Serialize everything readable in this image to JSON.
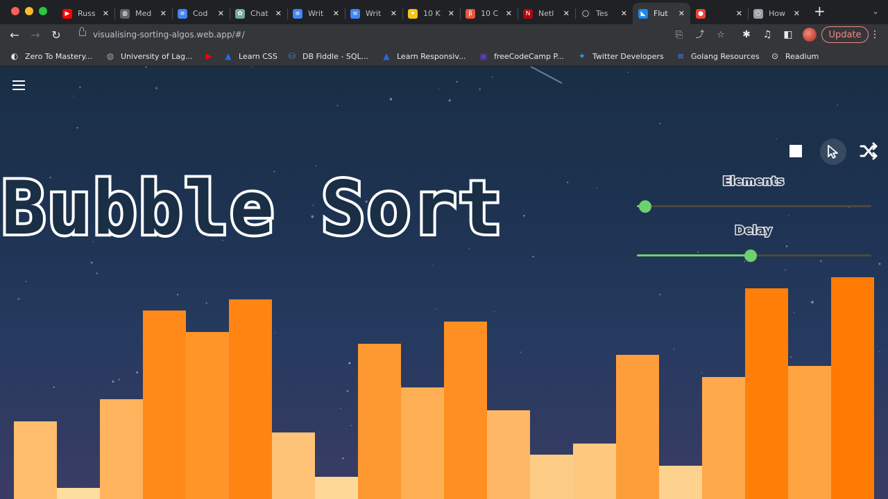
{
  "browser": {
    "tabs": [
      {
        "title": "Russ",
        "favicon": "youtube-icon",
        "color": "#ff0000",
        "glyph": "▶"
      },
      {
        "title": "Med",
        "favicon": "globe-icon",
        "color": "#5f6368",
        "glyph": "◍"
      },
      {
        "title": "Cod",
        "favicon": "docs-icon",
        "color": "#4285f4",
        "glyph": "≡"
      },
      {
        "title": "Chat",
        "favicon": "chatgpt-icon",
        "color": "#74aa9c",
        "glyph": "✿"
      },
      {
        "title": "Writ",
        "favicon": "docs-icon",
        "color": "#4285f4",
        "glyph": "≡"
      },
      {
        "title": "Writ",
        "favicon": "docs-icon",
        "color": "#4285f4",
        "glyph": "≡"
      },
      {
        "title": "10 K",
        "favicon": "star-icon",
        "color": "#f5c518",
        "glyph": "✦"
      },
      {
        "title": "10 C",
        "favicon": "hashnode-icon",
        "color": "#e8553e",
        "glyph": "β"
      },
      {
        "title": "Netl",
        "favicon": "netflix-icon",
        "color": "#b00710",
        "glyph": "N"
      },
      {
        "title": "Tes",
        "favicon": "github-icon",
        "color": "#24292e",
        "glyph": "◯"
      },
      {
        "title": "Flut",
        "favicon": "flutter-icon",
        "color": "#1e88e5",
        "glyph": "◣"
      },
      {
        "title": "",
        "favicon": "record-icon",
        "color": "#ea4335",
        "glyph": "●"
      },
      {
        "title": "How",
        "favicon": "cube-icon",
        "color": "#9aa0a6",
        "glyph": "⬡"
      }
    ],
    "active_tab_index": 10,
    "new_tab_label": "+",
    "url": "visualising-sorting-algos.web.app/#/",
    "update_label": "Update",
    "bookmarks": [
      {
        "label": "Zero To Mastery...",
        "icon": "ztm-icon",
        "color": "#e8eaed",
        "glyph": "◐"
      },
      {
        "label": "University of Lag...",
        "icon": "globe-icon",
        "color": "#9aa0a6",
        "glyph": "◍"
      },
      {
        "label": "",
        "icon": "youtube-icon",
        "color": "#ff0000",
        "glyph": "▶"
      },
      {
        "label": "Learn CSS",
        "icon": "css-icon",
        "color": "#2965f1",
        "glyph": "▲"
      },
      {
        "label": "DB Fiddle - SQL...",
        "icon": "database-icon",
        "color": "#3c7ee6",
        "glyph": "⛁"
      },
      {
        "label": "Learn Responsiv...",
        "icon": "css-icon",
        "color": "#2965f1",
        "glyph": "▲"
      },
      {
        "label": "freeCodeCamp P...",
        "icon": "fcc-icon",
        "color": "#5f3dc4",
        "glyph": "▣"
      },
      {
        "label": "Twitter Developers",
        "icon": "twitter-icon",
        "color": "#1da1f2",
        "glyph": "✦"
      },
      {
        "label": "Golang Resources",
        "icon": "docs-icon",
        "color": "#4285f4",
        "glyph": "≡"
      },
      {
        "label": "Readium",
        "icon": "readium-icon",
        "color": "#e8eaed",
        "glyph": "⊙"
      }
    ]
  },
  "app": {
    "title": "Bubble Sort",
    "controls": {
      "stop_icon": "stop-icon",
      "cursor_icon": "cursor-icon",
      "shuffle_icon": "shuffle-icon"
    },
    "elements_slider": {
      "label": "Elements",
      "value_fraction": 0.03
    },
    "delay_slider": {
      "label": "Delay",
      "value_fraction": 0.48
    },
    "colors": {
      "thumb": "#6ed06e",
      "bar_light": "#fde2a8",
      "bar_dark": "#ff7a00"
    }
  },
  "chart_data": {
    "type": "bar",
    "values": [
      112,
      16,
      144,
      272,
      241,
      288,
      96,
      32,
      224,
      161,
      256,
      128,
      64,
      80,
      208,
      48,
      176,
      304,
      192,
      320
    ],
    "ylim": [
      0,
      330
    ]
  }
}
